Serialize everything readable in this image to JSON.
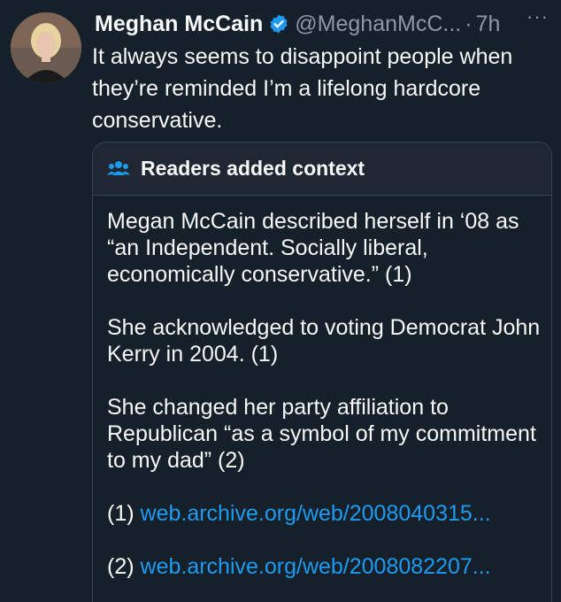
{
  "tweet": {
    "author_name": "Meghan McCain",
    "handle": "@MeghanMcC...",
    "separator": "·",
    "time": "7h",
    "more": "···",
    "text": "It always seems to disappoint people when they’re reminded I’m a lifelong hardcore conservative."
  },
  "context": {
    "title": "Readers added context",
    "icon": "people-icon",
    "paragraphs": [
      "Megan McCain described herself in ‘08 as “an Independent. Socially liberal, economically conservative.” (1)",
      "She acknowledged to voting Democrat John Kerry in 2004. (1)",
      "She changed her party affiliation to Republican “as a symbol of my commitment to my dad” (2)"
    ],
    "refs": [
      {
        "label": "(1)",
        "link": "web.archive.org/web/2008040315..."
      },
      {
        "label": "(2)",
        "link": "web.archive.org/web/2008082207..."
      }
    ]
  },
  "colors": {
    "background": "#15202b",
    "accent": "#1d9bf0",
    "muted": "#8b98a5",
    "border": "#38444d"
  }
}
